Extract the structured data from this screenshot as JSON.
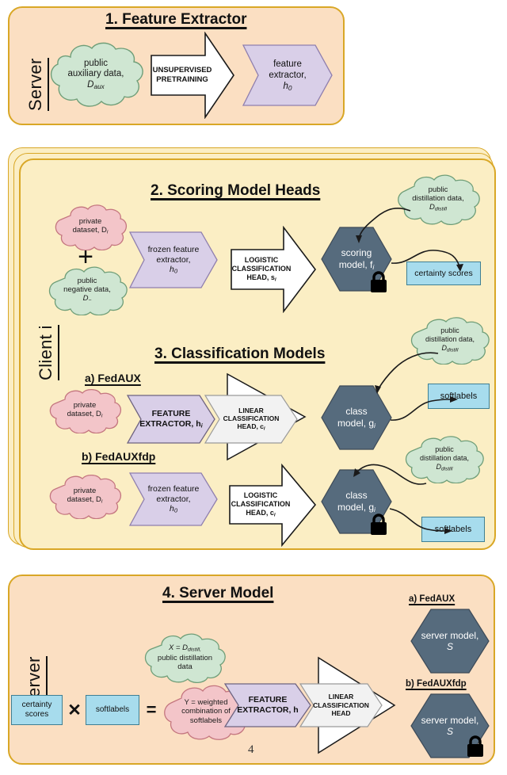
{
  "page_number": "4",
  "colors": {
    "server_panel": "#fbdfc2",
    "client_panel": "#fbeec4",
    "panel_border": "#d9a726",
    "cloud_green": "#cfe6d2",
    "cloud_pink": "#f3c5c9",
    "chevron_purple": "#d9cfe8",
    "chevron_white": "#ffffff",
    "chevron_gray": "#efefef",
    "hex_slate": "#566b7d",
    "box_blue": "#a7dced"
  },
  "sections": {
    "s1": {
      "side_label": "Server",
      "title": "1. Feature Extractor",
      "cloud_aux": {
        "line1": "public",
        "line2": "auxiliary data,",
        "line3": "D",
        "sub3": "aux"
      },
      "arrow": {
        "line1": "UNSUPERVISED",
        "line2": "PRETRAINING"
      },
      "chevron_extractor": {
        "line1": "feature",
        "line2": "extractor,",
        "line3": "h",
        "sub3": "0"
      }
    },
    "s2": {
      "side_label": "Client i",
      "title": "2. Scoring Model Heads",
      "cloud_private": {
        "line1": "private",
        "line2": "dataset, D",
        "sub2": "i"
      },
      "plus": "+",
      "cloud_negative": {
        "line1": "public",
        "line2": "negative data,",
        "line3": "D",
        "sub3": "−"
      },
      "chevron_frozen": {
        "line1": "frozen feature",
        "line2": "extractor,",
        "line3": "h",
        "sub3": "0"
      },
      "arrow_head": {
        "line1": "LOGISTIC",
        "line2": "CLASSIFICATION",
        "line3": "HEAD, s",
        "sub3": "i"
      },
      "cloud_distill": {
        "line1": "public",
        "line2": "distillation data,",
        "line3": "D",
        "sub3": "distill"
      },
      "hex_scoring": {
        "line1": "scoring",
        "line2": "model, f",
        "sub2": "i"
      },
      "box_certainty": {
        "line1": "certainty scores"
      },
      "lock": "lock-icon"
    },
    "s3": {
      "title": "3. Classification Models",
      "a": {
        "label": "a) FedAUX",
        "cloud_private": {
          "line1": "private",
          "line2": "dataset, D",
          "sub2": "i"
        },
        "chevron_fe": {
          "line1": "FEATURE",
          "line2": "EXTRACTOR, h",
          "sub2": "i"
        },
        "chevron_head": {
          "line1": "LINEAR",
          "line2": "CLASSIFICATION",
          "line3": "HEAD, c",
          "sub3": "i"
        },
        "cloud_distill": {
          "line1": "public",
          "line2": "distillation data,",
          "line3": "D",
          "sub3": "distill"
        },
        "hex_class": {
          "line1": "class",
          "line2": "model, g",
          "sub2": "i"
        },
        "box_softlabels": {
          "line1": "softlabels"
        }
      },
      "b": {
        "label": "b) FedAUXfdp",
        "cloud_private": {
          "line1": "private",
          "line2": "dataset, D",
          "sub2": "i"
        },
        "chevron_frozen": {
          "line1": "frozen feature",
          "line2": "extractor,",
          "line3": "h",
          "sub3": "0"
        },
        "arrow_head": {
          "line1": "LOGISTIC",
          "line2": "CLASSIFICATION",
          "line3": "HEAD, c",
          "sub3": "i"
        },
        "cloud_distill": {
          "line1": "public",
          "line2": "distillation data,",
          "line3": "D",
          "sub3": "distill"
        },
        "hex_class": {
          "line1": "class",
          "line2": "model, g",
          "sub2": "i"
        },
        "box_softlabels": {
          "line1": "softlabels"
        },
        "lock": "lock-icon"
      }
    },
    "s4": {
      "side_label": "Server",
      "title": "4. Server Model",
      "cloud_x": {
        "line1": "X = D",
        "sub1": "distill,",
        "line2": "public distillation",
        "line3": "data"
      },
      "box_certainty": {
        "line1": "certainty",
        "line2": "scores"
      },
      "times": "✕",
      "box_softlabels": {
        "line1": "softlabels"
      },
      "equals": "=",
      "cloud_y": {
        "line1": "Y = weighted",
        "line2": "combination of",
        "line3": "softlabels"
      },
      "chevron_fe": {
        "line1": "FEATURE",
        "line2": "EXTRACTOR, h"
      },
      "chevron_head": {
        "line1": "LINEAR",
        "line2": "CLASSIFICATION",
        "line3": "HEAD"
      },
      "a": {
        "label": "a) FedAUX",
        "hex": {
          "line1": "server model,",
          "line2": "S"
        }
      },
      "b": {
        "label": "b) FedAUXfdp",
        "hex": {
          "line1": "server model,",
          "line2": "S"
        },
        "lock": "lock-icon"
      }
    }
  }
}
